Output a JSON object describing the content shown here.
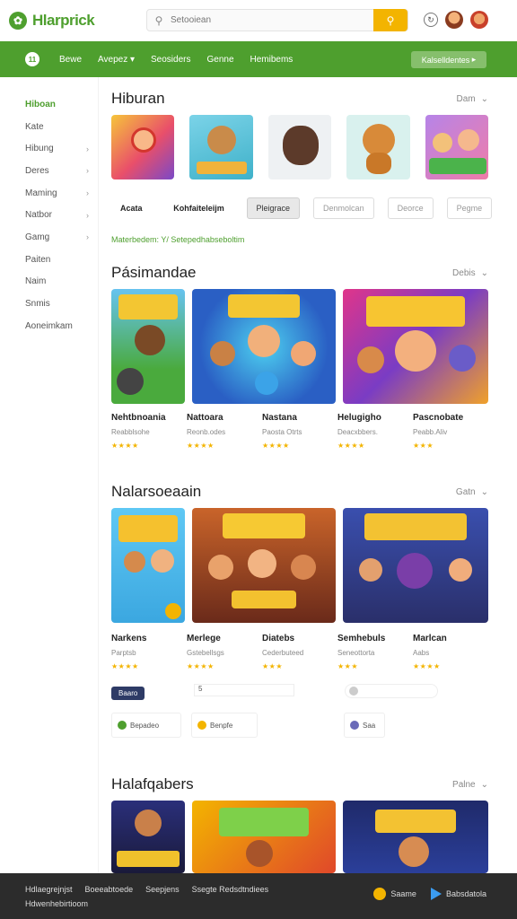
{
  "header": {
    "logo_text": "Hlarprick",
    "search_placeholder": "Setooiean"
  },
  "nav": {
    "badge": "11",
    "items": [
      "Bewe",
      "Avepez",
      "Seosiders",
      "Genne",
      "Hemibems"
    ],
    "cta": "Kalselldentes"
  },
  "sidebar": {
    "items": [
      {
        "label": "Hiboan",
        "chevron": false,
        "active": true
      },
      {
        "label": "Kate",
        "chevron": false
      },
      {
        "label": "Hibung",
        "chevron": true
      },
      {
        "label": "Deres",
        "chevron": true
      },
      {
        "label": "Maming",
        "chevron": true
      },
      {
        "label": "Natbor",
        "chevron": true
      },
      {
        "label": "Gamg",
        "chevron": true
      },
      {
        "label": "Paiten",
        "chevron": false
      },
      {
        "label": "Naim",
        "chevron": false
      },
      {
        "label": "Snmis",
        "chevron": false
      },
      {
        "label": "Aoneimkam",
        "chevron": false
      }
    ]
  },
  "section1": {
    "title": "Hiburan",
    "more": "Dam",
    "filters": [
      "Acata",
      "Kohfaiteleijm",
      "Pleigrace",
      "Denmolcan",
      "Deorce",
      "Pegme"
    ],
    "breadcrumb": "Materbedem: Y/ Setepedhabseboltim"
  },
  "section2": {
    "title": "Pásimandae",
    "more": "Debis",
    "cards": [
      {
        "title": "Nehtbnoania",
        "sub": "Reabblsohe",
        "stars": "★★★★"
      },
      {
        "title": "Nattoara",
        "sub": "Reonb.odes",
        "stars": "★★★★"
      },
      {
        "title": "Nastana",
        "sub": "Paosta Otrts",
        "stars": "★★★★"
      },
      {
        "title": "Helugigho",
        "sub": "Deacxbbers.",
        "stars": "★★★★"
      },
      {
        "title": "Pascnobate",
        "sub": "Peabb.Aliv",
        "stars": "★★★"
      }
    ]
  },
  "section3": {
    "title": "Nalarsoeaain",
    "more": "Gatn",
    "cards": [
      {
        "title": "Narkens",
        "sub": "Parptsb",
        "stars": "★★★★"
      },
      {
        "title": "Merlege",
        "sub": "Gstebellsgs",
        "stars": "★★★★"
      },
      {
        "title": "Diatebs",
        "sub": "Cederbuteed",
        "stars": "★★★"
      },
      {
        "title": "Semhebuls",
        "sub": "Seneottorta",
        "stars": "★★★"
      },
      {
        "title": "Marlcan",
        "sub": "Aabs",
        "stars": "★★★★"
      }
    ],
    "tag": "Baaro",
    "small_tag": "5",
    "pills": [
      "Bepadeo",
      "Benpfe",
      "Saa"
    ]
  },
  "section4": {
    "title": "Halafqabers",
    "more": "Palne"
  },
  "footer": {
    "line1": [
      "Hdlaegrejnjst",
      "Boeeabtoede",
      "Seepjens",
      "Ssegte Redsdtndiees"
    ],
    "line2": "Hdwenhebirtioom",
    "store1": "Saame",
    "store2": "Babsdatola"
  },
  "colors": {
    "brand_green": "#4e9f2e",
    "accent_yellow": "#f3b400"
  }
}
